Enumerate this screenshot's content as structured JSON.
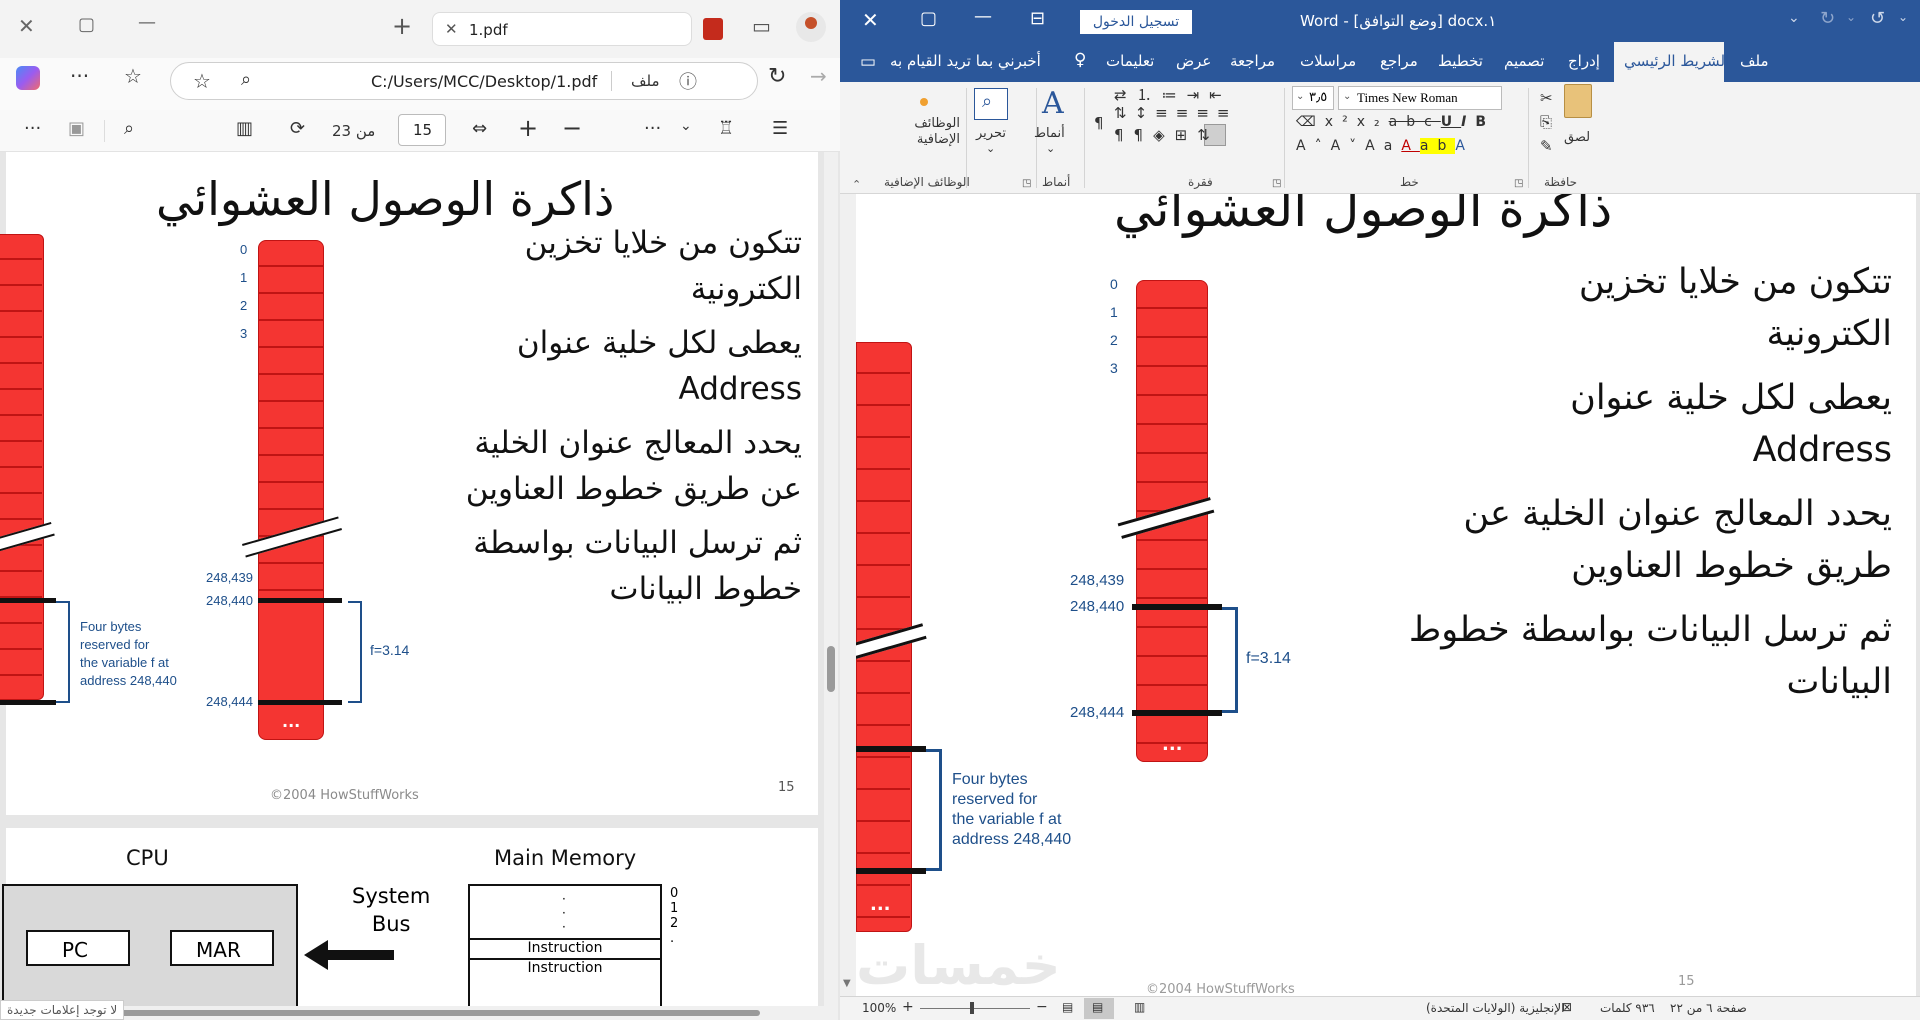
{
  "edge": {
    "tab_title": "1.pdf",
    "address_prefix": "ملف",
    "address": "C:/Users/MCC/Desktop/1.pdf",
    "page_input": "15",
    "page_of": "من 23",
    "notice": "لا توجد إعلامات جديدة"
  },
  "slide": {
    "title": "ذاكرة الوصول العشوائي",
    "bullets": [
      {
        "l1": "تتكون من خلايا تخزين",
        "l2": "الكترونية"
      },
      {
        "l1": "يعطى لكل خلية عنوان",
        "l2": "Address"
      },
      {
        "l1": "يحدد المعالج عنوان الخلية",
        "l2": "عن طريق خطوط العناوين"
      },
      {
        "l1": "ثم ترسل البيانات بواسطة",
        "l2": "خطوط البيانات"
      }
    ],
    "addr_labels": [
      "0",
      "1",
      "2",
      "3"
    ],
    "addr_249": "248,439",
    "addr_240": "248,440",
    "addr_244": "248,444",
    "reserved": [
      "Four bytes",
      "reserved for",
      "the variable f at",
      "address 248,440"
    ],
    "f_value": "f=3.14",
    "dots": "...",
    "copyright": "©2004 HowStuffWorks",
    "page_number": "15"
  },
  "next_slide": {
    "cpu": "CPU",
    "pc": "PC",
    "mar": "MAR",
    "system_bus": [
      "System",
      "Bus"
    ],
    "main_memory": "Main Memory",
    "mem_rows": [
      "0",
      "1",
      "2"
    ],
    "instruction": "Instruction",
    "instruction2": "Instruction"
  },
  "word": {
    "signin": "تسجيل الدخول",
    "title": "١.docx  [وضع التوافق]  -  Word",
    "tabs": [
      "ملف",
      "الشريط الرئيسي",
      "إدراج",
      "تصميم",
      "تخطيط",
      "مراجع",
      "مراسلات",
      "مراجعة",
      "عرض",
      "تعليمات"
    ],
    "tell_me": "أخبرني بما تريد القيام به",
    "font_name": "Times New Roman",
    "font_size": "٣٫٥",
    "groups": {
      "clipboard": "حافظة",
      "font": "خط",
      "paragraph": "فقرة",
      "styles": "أنماط",
      "addins": "الوظائف الإضافية"
    },
    "paste": "لصق",
    "styles_btn": "أنماط",
    "editing_btn": "تحرير",
    "addins_btn": [
      "الوظائف",
      "الإضافية"
    ],
    "doc": {
      "title": "ذاكرة الوصول العشوائي",
      "bullets": [
        {
          "l1": "تتكون من خلايا تخزين",
          "l2": "الكترونية"
        },
        {
          "l1": "يعطى لكل خلية عنوان",
          "l2": "Address"
        },
        {
          "l1": "يحدد المعالج عنوان الخلية عن",
          "l2": "طريق خطوط العناوين"
        },
        {
          "l1": "ثم ترسل البيانات بواسطة خطوط",
          "l2": "البيانات"
        }
      ],
      "copyright": "©2004 HowStuffWorks",
      "page_number": "15",
      "watermark": "خمسات"
    },
    "status": {
      "page": "صفحة ٦ من ٢٢",
      "words": "٩٣٦ كلمات",
      "language": "الإنجليزية (الولايات المتحدة)",
      "zoom": "100%"
    }
  },
  "colors": {
    "word_blue": "#2b579a",
    "cell_red": "#f43532",
    "label_blue": "#1e4f8a"
  }
}
